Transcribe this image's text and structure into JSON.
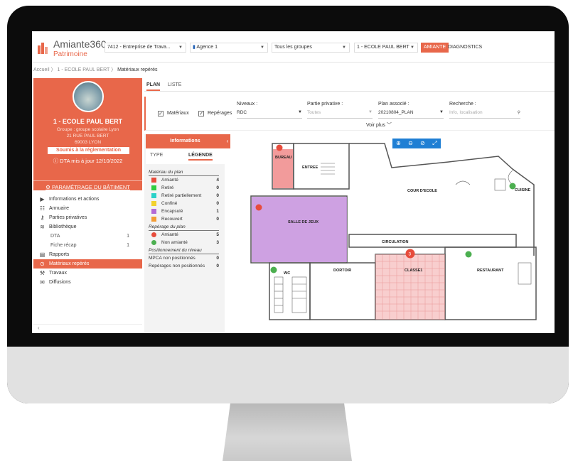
{
  "app": {
    "title": "Amiante360",
    "subtitle": "Patrimoine"
  },
  "topbar": {
    "entreprise": "7412 - Entreprise de Trava...",
    "agence": "Agence 1",
    "groupes": "Tous les groupes",
    "ecole": "1 - ECOLE PAUL BERT",
    "btn_amiante": "AMIANTE",
    "btn_diagnostics": "DIAGNOSTICS"
  },
  "breadcrumb": {
    "home": "Accueil",
    "sep1": "〉",
    "school": "1 - ECOLE PAUL BERT",
    "sep2": "〉",
    "current": "Matériaux repérés"
  },
  "building": {
    "name": "1 - ECOLE PAUL BERT",
    "groupe": "Groupe : groupe scolaire Lyon",
    "address": "21 RUE PAUL BERT",
    "city": "69003 LYON",
    "status": "Soumis à la réglementation",
    "dta": "DTA mis à jour 12/10/2022",
    "param": "PARAMÉTRAGE DU BÂTIMENT"
  },
  "menu": [
    {
      "label": "Informations et actions",
      "icon": "info-circle-icon",
      "glyph": "▶"
    },
    {
      "label": "Annuaire",
      "icon": "contact-card-icon",
      "glyph": "☷"
    },
    {
      "label": "Parties privatives",
      "icon": "key-icon",
      "glyph": "⚷"
    },
    {
      "label": "Bibliothèque",
      "icon": "books-icon",
      "glyph": "≋"
    },
    {
      "label": "DTA",
      "count": "1",
      "sub": true
    },
    {
      "label": "Fiche récap",
      "count": "1",
      "sub": true
    },
    {
      "label": "Rapports",
      "icon": "report-icon",
      "glyph": "▤"
    },
    {
      "label": "Matériaux repérés",
      "icon": "location-pin-icon",
      "glyph": "⊙",
      "active": true
    },
    {
      "label": "Travaux",
      "icon": "worker-icon",
      "glyph": "⚒"
    },
    {
      "label": "Diffusions",
      "icon": "envelope-icon",
      "glyph": "✉"
    }
  ],
  "sidebar_footer": "‹",
  "tabs": {
    "plan": "PLAN",
    "liste": "LISTE"
  },
  "filters": {
    "materiaux": "Matériaux",
    "reperages": "Repérages",
    "niveaux_label": "Niveaux :",
    "niveaux_value": "RDC",
    "partie_label": "Partie privative :",
    "partie_value": "Toutes",
    "plan_label": "Plan associé :",
    "plan_value": "20210804_PLAN",
    "recherche_label": "Recherche :",
    "recherche_placeholder": "Info, localisation",
    "voir_plus": "Voir plus"
  },
  "info_panel": {
    "title": "Informations",
    "tab_type": "TYPE",
    "tab_legende": "LÉGENDE"
  },
  "legend": {
    "materiau_title": "Matériau du plan",
    "materiaux": [
      {
        "label": "Amianté",
        "count": "4",
        "color": "#e74c3c"
      },
      {
        "label": "Retiré",
        "count": "0",
        "color": "#2ecc40"
      },
      {
        "label": "Retiré partiellement",
        "count": "0",
        "color": "#2bd1c8"
      },
      {
        "label": "Confiné",
        "count": "0",
        "color": "#f2d22e"
      },
      {
        "label": "Encapsulé",
        "count": "1",
        "color": "#b36ad6"
      },
      {
        "label": "Recouvert",
        "count": "0",
        "color": "#f39c34"
      }
    ],
    "reperage_title": "Repérage du plan",
    "reperages": [
      {
        "label": "Amianté",
        "count": "5",
        "color": "#e74c3c"
      },
      {
        "label": "Non amianté",
        "count": "3",
        "color": "#4caf50"
      }
    ],
    "position_title": "Positionnement du niveau",
    "positions": [
      {
        "label": "MPCA non positionnés",
        "count": "0"
      },
      {
        "label": "Repérages non positionnés",
        "count": "0"
      }
    ]
  },
  "plan": {
    "rooms": [
      "BUREAU",
      "ENTREE",
      "COUR D'ECOLE",
      "CUISINE",
      "SALLE DE JEUX",
      "CIRCULATION",
      "WC",
      "DORTOIR",
      "CLASSE1",
      "RESTAURANT"
    ],
    "marker_count": "3"
  },
  "plan_tools": [
    "zoom-in-icon",
    "zoom-out-icon",
    "zoom-reset-icon",
    "fullscreen-icon"
  ]
}
